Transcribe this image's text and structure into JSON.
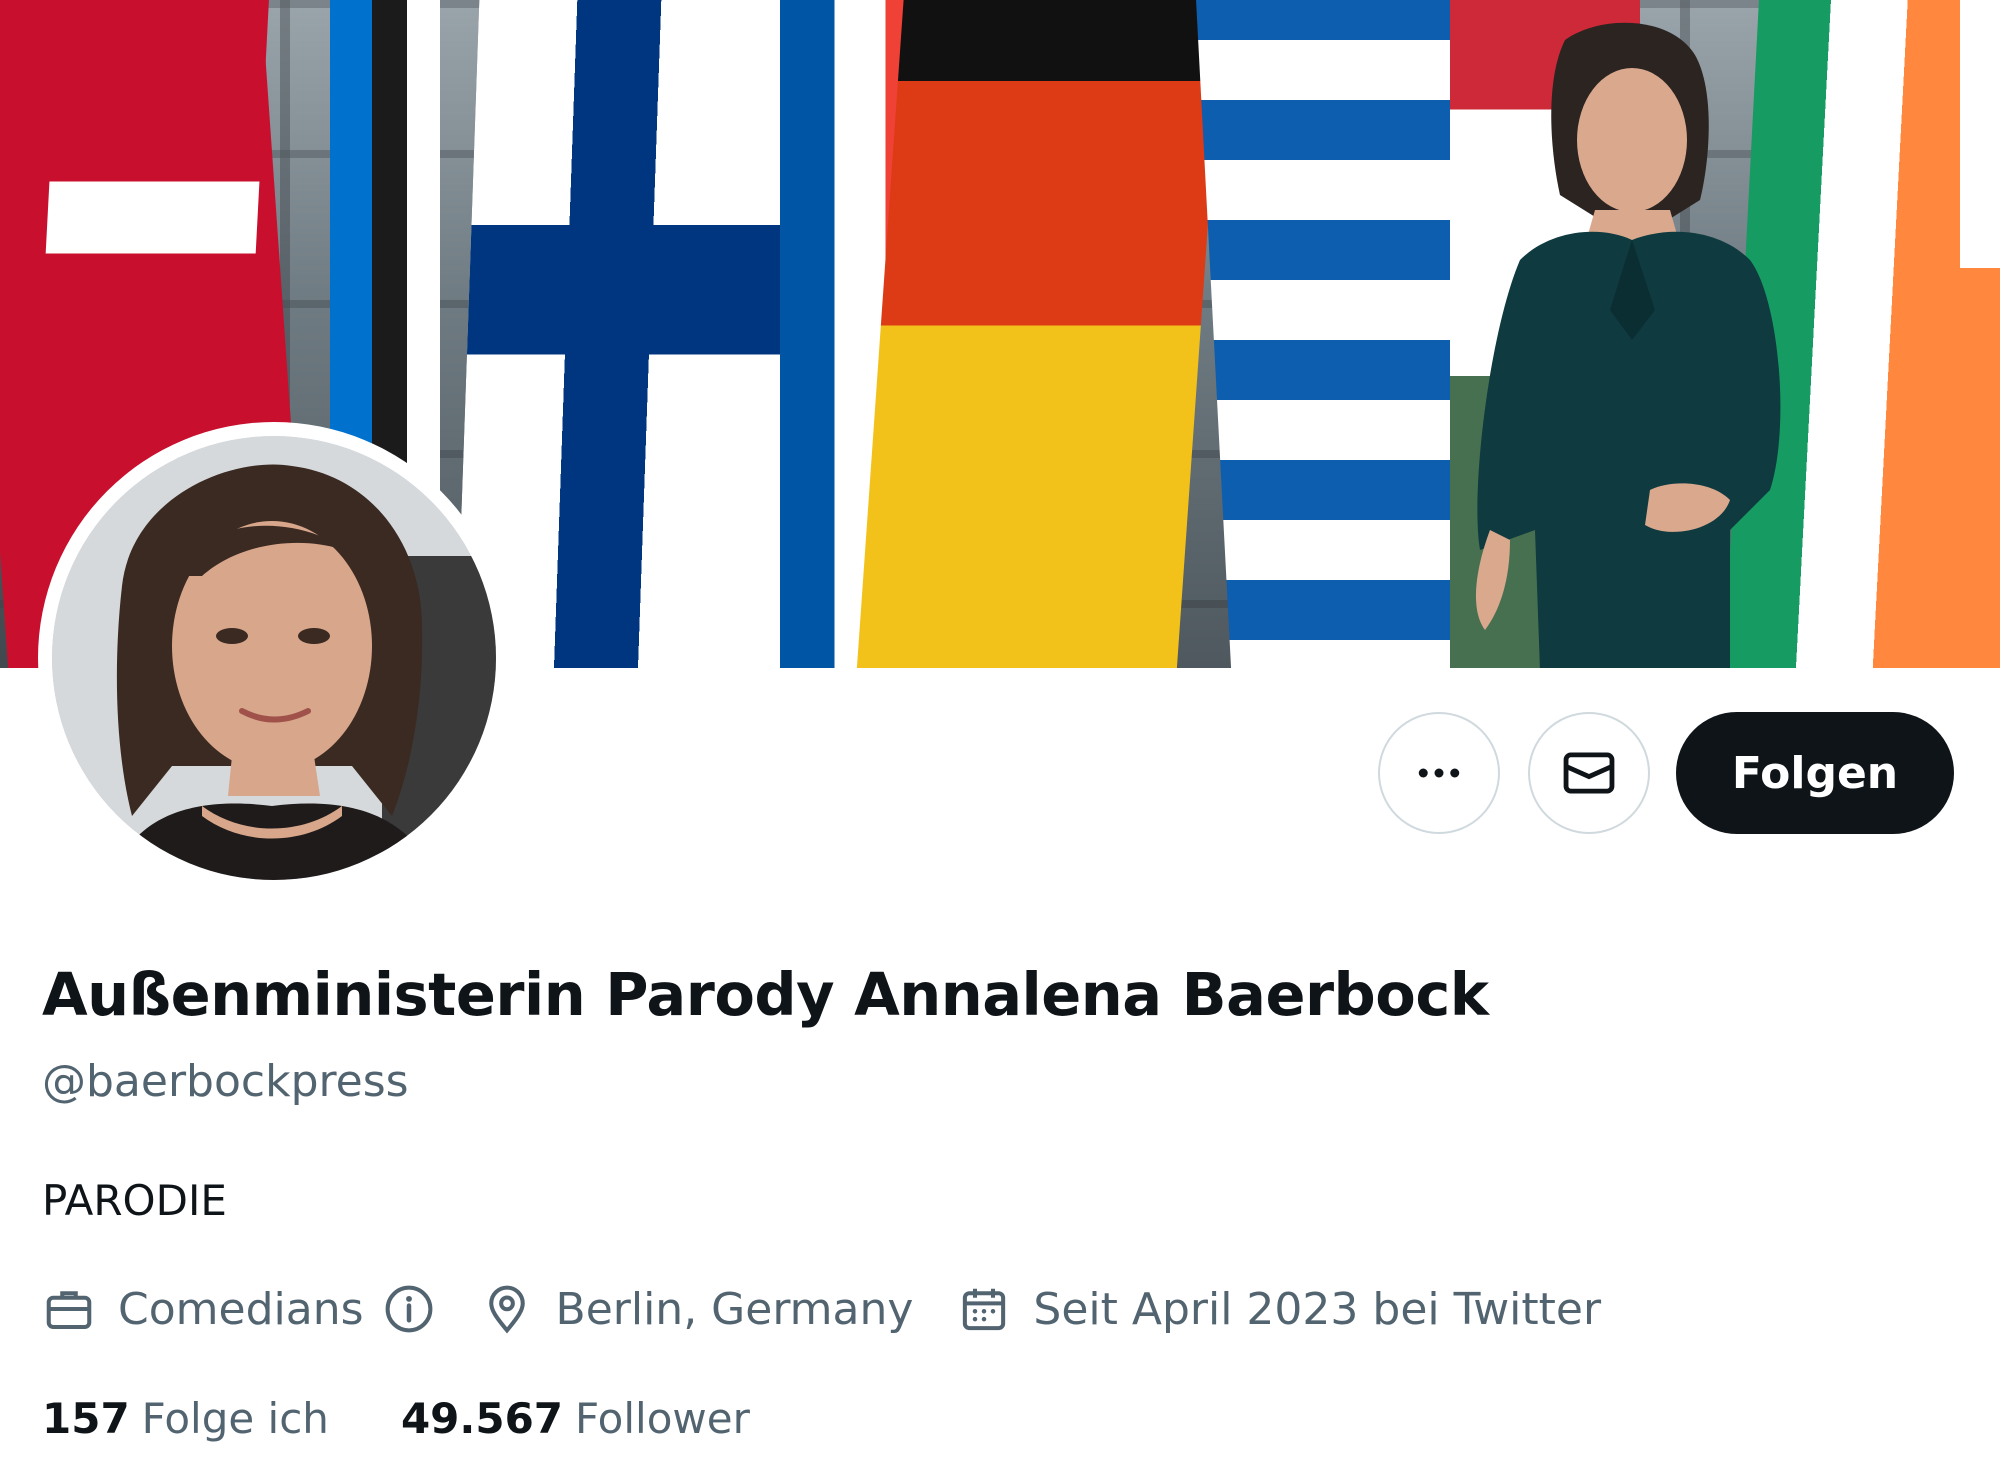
{
  "banner": {
    "alt": "Profilbanner: Frau vor europäischen Flaggen",
    "flags": [
      {
        "name": "denmark",
        "colors": [
          "#c8102e",
          "#ffffff"
        ]
      },
      {
        "name": "estonia",
        "colors": [
          "#0072ce",
          "#000000",
          "#ffffff"
        ]
      },
      {
        "name": "finland",
        "colors": [
          "#ffffff",
          "#003580"
        ]
      },
      {
        "name": "france",
        "colors": [
          "#0055a4",
          "#ffffff",
          "#ef4135"
        ]
      },
      {
        "name": "germany",
        "colors": [
          "#000000",
          "#dd0000",
          "#ffce00"
        ]
      },
      {
        "name": "greece",
        "colors": [
          "#0d5eaf",
          "#ffffff"
        ]
      },
      {
        "name": "hungary",
        "colors": [
          "#ce2939",
          "#ffffff",
          "#477050"
        ]
      },
      {
        "name": "ireland",
        "colors": [
          "#169b62",
          "#ffffff",
          "#ff883e"
        ]
      }
    ]
  },
  "profile": {
    "display_name": "Außenministerin Parody Annalena Baerbock",
    "handle": "@baerbockpress",
    "bio": "PARODIE",
    "category": "Comedians",
    "location": "Berlin, Germany",
    "joined": "Seit April 2023 bei Twitter",
    "following_count": "157",
    "following_label": "Folge ich",
    "followers_count": "49.567",
    "followers_label": "Follower"
  },
  "actions": {
    "more_icon": "more-horizontal-icon",
    "message_icon": "envelope-icon",
    "follow_label": "Folgen"
  },
  "icons": {
    "category": "briefcase-icon",
    "category_info": "info-icon",
    "location": "location-pin-icon",
    "joined": "calendar-icon"
  },
  "colors": {
    "text_primary": "#0f1419",
    "text_secondary": "#536471",
    "follow_button_bg": "#0f1419",
    "border": "#cfd9de"
  }
}
